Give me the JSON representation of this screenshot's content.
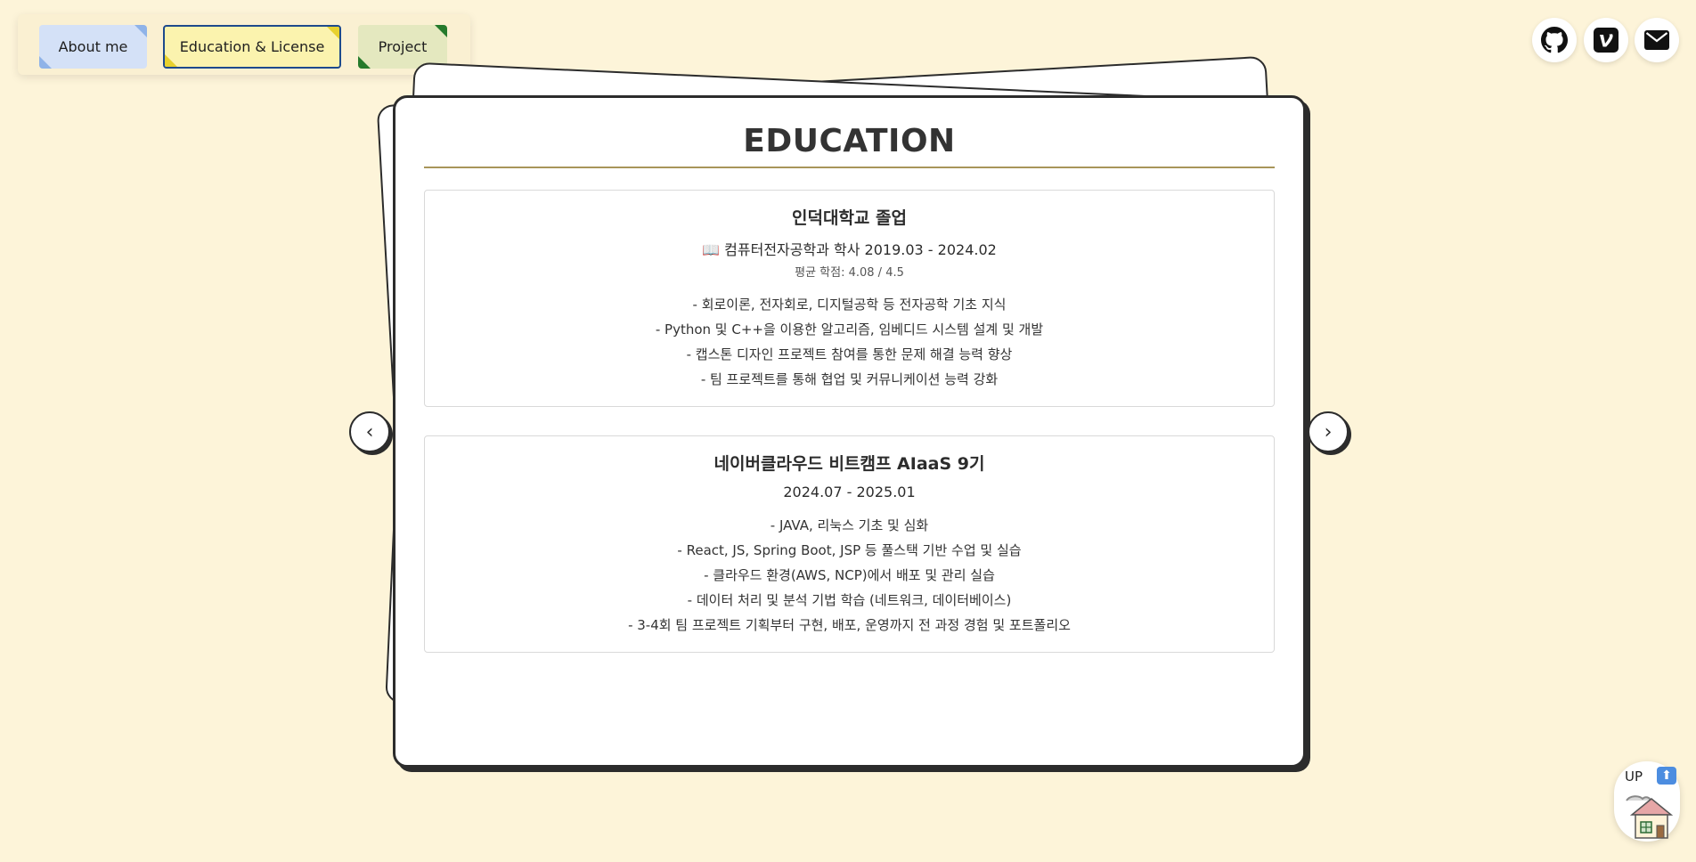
{
  "nav": {
    "tabs": [
      {
        "label": "About me"
      },
      {
        "label": "Education & License",
        "active": true
      },
      {
        "label": "Project"
      }
    ]
  },
  "social": {
    "icons": [
      "github-icon",
      "velog-icon",
      "mail-icon"
    ]
  },
  "education": {
    "title": "EDUCATION",
    "items": [
      {
        "name": "인덕대학교 졸업",
        "subtitle": "📖 컴퓨터전자공학과 학사 2019.03 - 2024.02",
        "gpa": "평균 학점: 4.08 / 4.5",
        "bullets": [
          "- 회로이론, 전자회로, 디지털공학 등 전자공학 기초 지식",
          "- Python 및 C++을 이용한 알고리즘, 임베디드 시스템 설계 및 개발",
          "- 캡스톤 디자인 프로젝트 참여를 통한 문제 해결 능력 향상",
          "- 팀 프로젝트를 통해 협업 및 커뮤니케이션 능력 강화"
        ]
      },
      {
        "name": "네이버클라우드 비트캠프 AIaaS 9기",
        "subtitle": "2024.07 - 2025.01",
        "bullets": [
          "- JAVA, 리눅스 기초 및 심화",
          "- React, JS, Spring Boot, JSP 등 풀스택 기반 수업 및 실습",
          "- 클라우드 환경(AWS, NCP)에서 배포 및 관리 실습",
          "- 데이터 처리 및 분석 기법 학습 (네트워크, 데이터베이스)",
          "- 3-4회 팀 프로젝트 기획부터 구현, 배포, 운영까지 전 과정 경험 및 포트폴리오"
        ]
      }
    ]
  },
  "carousel": {
    "prev_symbol": "‹",
    "next_symbol": "›"
  },
  "scroll_top": {
    "label": "UP",
    "arrow_symbol": "⬆"
  },
  "colors": {
    "background": "#fdf4d9",
    "tab_about": "#d4e1f7",
    "tab_education": "#fbf3ae",
    "tab_project": "#e4e8bf",
    "title_rule": "#a8955a"
  }
}
